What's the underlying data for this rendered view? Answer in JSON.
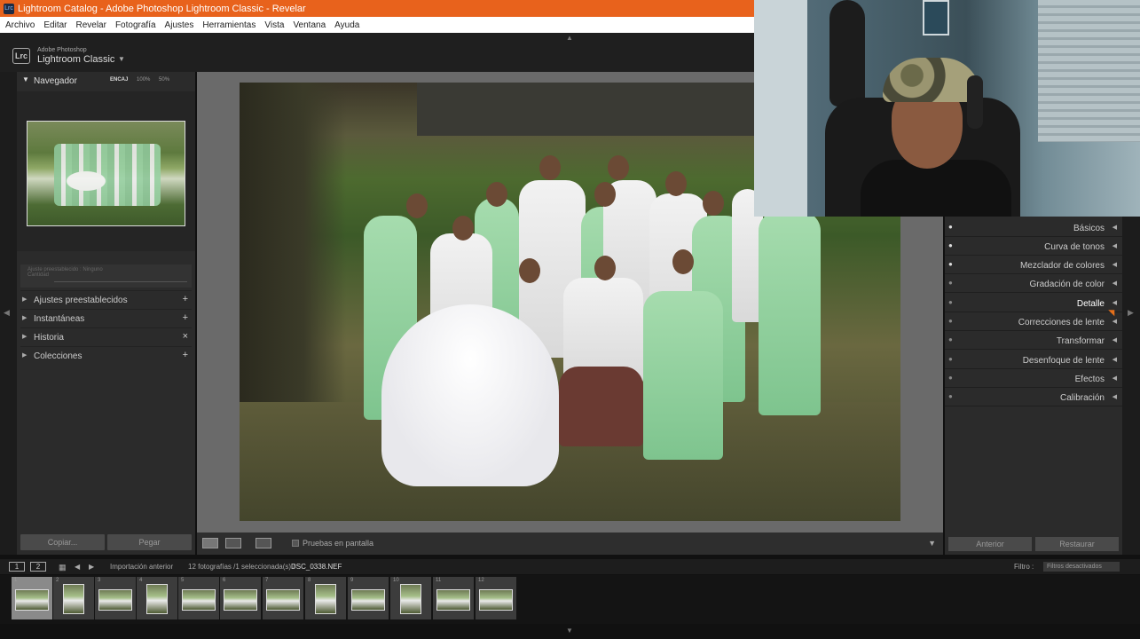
{
  "window": {
    "title": "Lightroom Catalog - Adobe Photoshop Lightroom Classic - Revelar",
    "app_icon": "Lrc"
  },
  "menu": [
    "Archivo",
    "Editar",
    "Revelar",
    "Fotografía",
    "Ajustes",
    "Herramientas",
    "Vista",
    "Ventana",
    "Ayuda"
  ],
  "brand": {
    "badge": "Lrc",
    "small": "Adobe Photoshop",
    "big": "Lightroom Classic",
    "caret": "▼"
  },
  "navigator": {
    "title": "Navegador",
    "zooms": [
      {
        "label": "ENCAJ",
        "selected": true
      },
      {
        "label": "100%",
        "selected": false
      },
      {
        "label": "50%",
        "selected": false
      }
    ]
  },
  "preset_amount": {
    "label": "Ajuste preestablecido : Ninguno",
    "sub": "Cantidad",
    "value": "100"
  },
  "left_sections": [
    {
      "label": "Ajustes preestablecidos",
      "action": "+"
    },
    {
      "label": "Instantáneas",
      "action": "+"
    },
    {
      "label": "Historia",
      "action": "×"
    },
    {
      "label": "Colecciones",
      "action": "+"
    }
  ],
  "left_buttons": {
    "copy": "Copiar...",
    "paste": "Pegar"
  },
  "toolbar": {
    "soft_proof": "Pruebas en pantalla"
  },
  "right_sections": [
    {
      "label": "Básicos",
      "eye_on": true,
      "highlighted": false
    },
    {
      "label": "Curva de tonos",
      "eye_on": true,
      "highlighted": false
    },
    {
      "label": "Mezclador de colores",
      "eye_on": true,
      "highlighted": false
    },
    {
      "label": "Gradación de color",
      "eye_on": false,
      "highlighted": false
    },
    {
      "label": "Detalle",
      "eye_on": false,
      "highlighted": true
    },
    {
      "label": "Correcciones de lente",
      "eye_on": false,
      "highlighted": false
    },
    {
      "label": "Transformar",
      "eye_on": false,
      "highlighted": false
    },
    {
      "label": "Desenfoque de lente",
      "eye_on": false,
      "highlighted": false
    },
    {
      "label": "Efectos",
      "eye_on": false,
      "highlighted": false
    },
    {
      "label": "Calibración",
      "eye_on": false,
      "highlighted": false
    }
  ],
  "right_buttons": {
    "previous": "Anterior",
    "reset": "Restaurar"
  },
  "filmbar": {
    "monitor1": "1",
    "monitor2": "2",
    "source": "Importación anterior",
    "count": "12 fotografías /1 seleccionada(s) /",
    "filename": "DSC_0338.NEF",
    "filter_label": "Filtro :",
    "filter_value": "Filtros desactivados"
  },
  "filmstrip": [
    {
      "num": "1",
      "selected": true,
      "orientation": "landscape"
    },
    {
      "num": "2",
      "selected": false,
      "orientation": "portrait"
    },
    {
      "num": "3",
      "selected": false,
      "orientation": "landscape"
    },
    {
      "num": "4",
      "selected": false,
      "orientation": "portrait"
    },
    {
      "num": "5",
      "selected": false,
      "orientation": "landscape"
    },
    {
      "num": "6",
      "selected": false,
      "orientation": "landscape"
    },
    {
      "num": "7",
      "selected": false,
      "orientation": "landscape"
    },
    {
      "num": "8",
      "selected": false,
      "orientation": "portrait"
    },
    {
      "num": "9",
      "selected": false,
      "orientation": "landscape"
    },
    {
      "num": "10",
      "selected": false,
      "orientation": "portrait"
    },
    {
      "num": "11",
      "selected": false,
      "orientation": "landscape"
    },
    {
      "num": "12",
      "selected": false,
      "orientation": "landscape"
    }
  ],
  "colors": {
    "titlebar": "#e8621c",
    "accent_cursor": "#e5701b"
  }
}
